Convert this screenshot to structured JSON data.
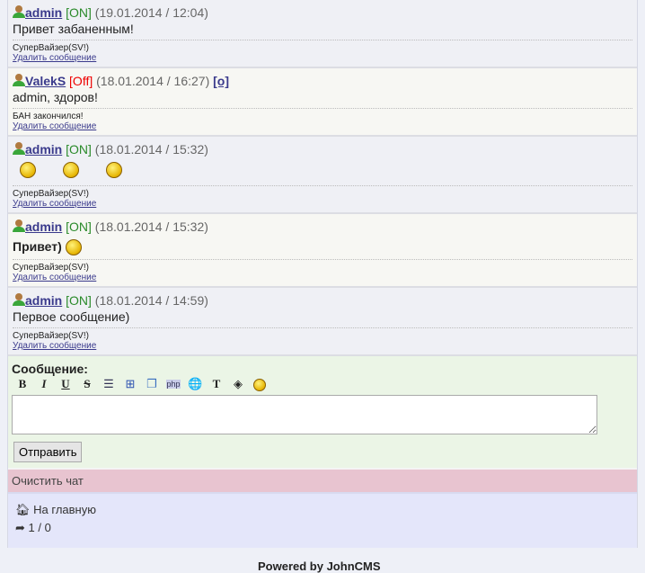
{
  "messages": [
    {
      "user": "admin",
      "status": "[ON]",
      "status_type": "on",
      "date": "(19.01.2014 / 12:04)",
      "text": "Привет забаненным!",
      "signature": "СуперВайзер(SV!)",
      "delete": "Удалить сообщение",
      "extra": ""
    },
    {
      "user": "ValekS",
      "status": "[Off]",
      "status_type": "off",
      "date": "(18.01.2014 / 16:27)",
      "text": "admin, здоров!",
      "signature": "БАН закончился!",
      "delete": "Удалить сообщение",
      "extra": "[о]"
    },
    {
      "user": "admin",
      "status": "[ON]",
      "status_type": "on",
      "date": "(18.01.2014 / 15:32)",
      "text": "",
      "signature": "СуперВайзер(SV!)",
      "delete": "Удалить сообщение",
      "extra": ""
    },
    {
      "user": "admin",
      "status": "[ON]",
      "status_type": "on",
      "date": "(18.01.2014 / 15:32)",
      "text": "Привет)",
      "signature": "СуперВайзер(SV!)",
      "delete": "Удалить сообщение",
      "extra": ""
    },
    {
      "user": "admin",
      "status": "[ON]",
      "status_type": "on",
      "date": "(18.01.2014 / 14:59)",
      "text": "Первое сообщение)",
      "signature": "СуперВайзер(SV!)",
      "delete": "Удалить сообщение",
      "extra": ""
    }
  ],
  "form": {
    "label": "Сообщение:",
    "submit": "Отправить",
    "toolbar": [
      "bold",
      "italic",
      "underline",
      "strike",
      "list",
      "spoiler",
      "quote",
      "php",
      "url",
      "color",
      "bgcolor",
      "smileys"
    ]
  },
  "clear_chat": "Очистить чат",
  "footer": {
    "home": "На главную",
    "counter": "1 / 0"
  },
  "powered": "Powered by JohnCMS"
}
